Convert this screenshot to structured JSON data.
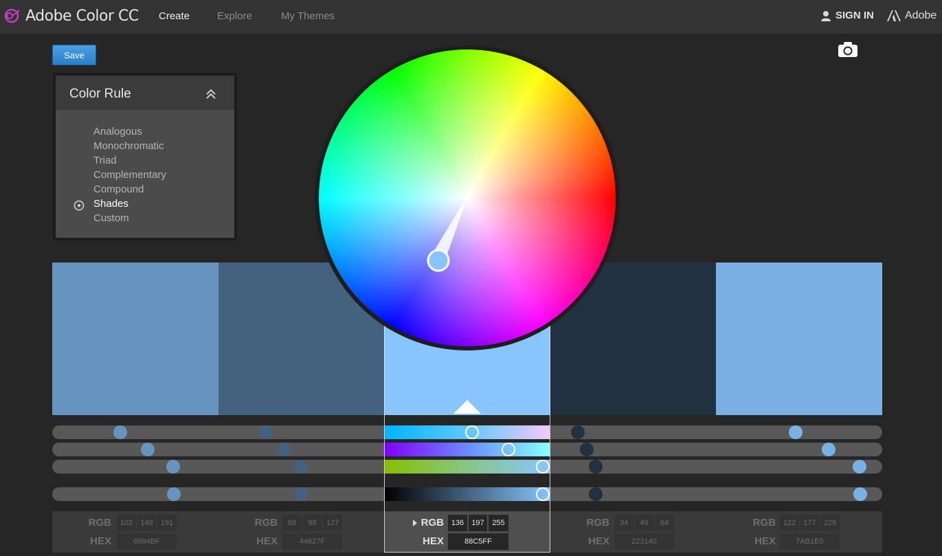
{
  "header": {
    "brand": "Adobe Color CC",
    "nav": [
      "Create",
      "Explore",
      "My Themes"
    ],
    "signin": "SIGN IN",
    "adobe": "Adobe"
  },
  "toolbar": {
    "save_label": "Save"
  },
  "color_rule": {
    "title": "Color Rule",
    "items": [
      "Analogous",
      "Monochromatic",
      "Triad",
      "Complementary",
      "Compound",
      "Shades",
      "Custom"
    ],
    "selected": "Shades"
  },
  "swatches": [
    {
      "color": "#6694BF",
      "rgb": [
        "102",
        "148",
        "191"
      ],
      "hex": "6694BF"
    },
    {
      "color": "#44627F",
      "rgb": [
        "68",
        "98",
        "127"
      ],
      "hex": "44627F"
    },
    {
      "color": "#88C5FF",
      "rgb": [
        "136",
        "197",
        "255"
      ],
      "hex": "88C5FF"
    },
    {
      "color": "#223140",
      "rgb": [
        "34",
        "49",
        "64"
      ],
      "hex": "223140"
    },
    {
      "color": "#7AB1E5",
      "rgb": [
        "122",
        "177",
        "229"
      ],
      "hex": "7AB1E5"
    }
  ],
  "active_swatch": 2,
  "labels": {
    "rgb": "RGB",
    "hex": "HEX"
  }
}
